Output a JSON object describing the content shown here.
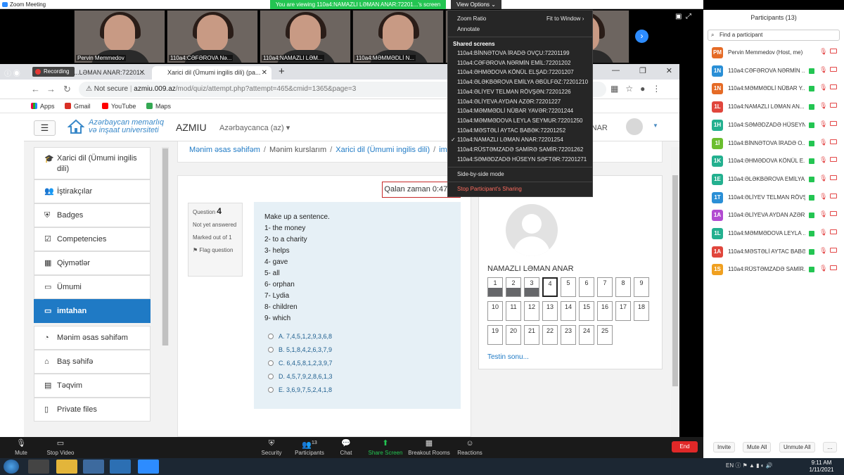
{
  "zoom": {
    "window_title": "Zoom Meeting",
    "viewing_banner": "You are viewing 110a4:NAMAZLI LƏMAN ANAR:72201...'s screen",
    "view_options": "View Options"
  },
  "thumbnails": [
    {
      "name": "Pervin Memmedov"
    },
    {
      "name": "110a4:CƏFƏROVA Nə..."
    },
    {
      "name": "110a4:NAMAZLI LƏM..."
    },
    {
      "name": "110a4:MƏMMƏDLİ N..."
    },
    {
      "name": ""
    },
    {
      "name": ""
    }
  ],
  "browser": {
    "tab1": "Recording...LƏMAN ANAR:72201...",
    "tab2": "Xarici dil (Ümumi ingilis dili) (pa...",
    "recording_badge": "Recording",
    "not_secure": "Not secure",
    "host": "azmiu.009.az",
    "path": "/mod/quiz/attempt.php?attempt=465&cmid=1365&page=3",
    "bookmarks": [
      "Apps",
      "Gmail",
      "YouTube",
      "Maps"
    ]
  },
  "site": {
    "logo_line1": "Azərbaycan memarlıq",
    "logo_line2": "və inşaat universiteti",
    "brand": "AZMIU",
    "language": "Azərbaycanca (az)",
    "user_name": "LƏMAN ANAR"
  },
  "sidebar": {
    "items": [
      {
        "label": "Xarici dil (Ümumi ingilis dili)",
        "icon": "graduation-cap-icon"
      },
      {
        "label": "İştirakçılar",
        "icon": "users-icon"
      },
      {
        "label": "Badges",
        "icon": "shield-icon"
      },
      {
        "label": "Competencies",
        "icon": "checkbox-icon"
      },
      {
        "label": "Qiymətlər",
        "icon": "table-icon"
      },
      {
        "label": "Ümumi",
        "icon": "folder-icon"
      },
      {
        "label": "imtahan",
        "icon": "folder-icon"
      },
      {
        "label": "Mənim əsas səhifəm",
        "icon": "dashboard-icon"
      },
      {
        "label": "Baş səhifə",
        "icon": "home-icon"
      },
      {
        "label": "Təqvim",
        "icon": "calendar-icon"
      },
      {
        "label": "Private files",
        "icon": "file-icon"
      }
    ]
  },
  "breadcrumb": {
    "items": [
      "Mənim əsas səhifəm",
      "Mənim kurslarım",
      "Xarici dil (Ümumi ingilis dili)",
      "im"
    ]
  },
  "quiz": {
    "timer_label": "Qalan zaman 0:47:01",
    "question_word": "Question",
    "question_number": "4",
    "status": "Not yet answered",
    "marked": "Marked out of 1",
    "flag": "Flag question",
    "prompt": "Make up a sentence.",
    "items": [
      "1- the money",
      "2- to a charity",
      "3- helps",
      "4- gave",
      "5- all",
      "6- orphan",
      "7- Lydia",
      "8- children",
      "9- which"
    ],
    "options": [
      "A. 7,4,5,1,2,9,3,6,8",
      "B. 5,1,8,4,2,6,3,7,9",
      "C. 6,4,5,8,1,2,3,9,7",
      "D. 4,5,7,9,2,8,6,1,3",
      "E. 3,6,9,7,5,2,4,1,8"
    ]
  },
  "quiz_nav": {
    "header": "QUIZ NAVIGATION",
    "student": "NAMAZLI LƏMAN ANAR",
    "buttons": [
      "1",
      "2",
      "3",
      "4",
      "5",
      "6",
      "7",
      "8",
      "9",
      "10",
      "11",
      "12",
      "13",
      "14",
      "15",
      "16",
      "17",
      "18",
      "19",
      "20",
      "21",
      "22",
      "23",
      "24",
      "25"
    ],
    "answered_count": 3,
    "current": "4",
    "finish": "Testin sonu..."
  },
  "dropdown": {
    "zoom_ratio": "Zoom Ratio",
    "fit_to_window": "Fit to Window",
    "annotate": "Annotate",
    "shared_screens_header": "Shared screens",
    "screens": [
      "110a4:BİNNƏTOVA İRADƏ OVÇU:72201199",
      "110a4:CƏFƏROVA NƏRMİN EMİL:72201202",
      "110a4:ƏHMƏDOVA KÖNÜL ELŞAD:72201207",
      "110a4:ƏLƏKBƏROVA EMİLYA ƏBÜLFƏZ:72201210",
      "110a4:ƏLİYEV TELMAN RÖVŞƏN:72201226",
      "110a4:ƏLİYEVA AYDAN AZƏR:72201227",
      "110a4:MƏMMƏDLİ NÜBAR YAVƏR:72201244",
      "110a4:MƏMMƏDOVA LEYLA SEYMUR:72201250",
      "110a4:MƏSTƏLİ AYTAC BABƏK:72201252",
      "110a4:NAMAZLI LƏMAN ANAR:72201254",
      "110a4:RÜSTƏMZADƏ SAMİRƏ SAMİR:72201262",
      "110a4:SƏMƏDZADƏ HÜSEYN SƏFTƏR:72201271"
    ],
    "checked_index": 9,
    "side_by_side": "Side-by-side mode",
    "stop": "Stop Participant's Sharing"
  },
  "participants": {
    "title": "Participants (13)",
    "search_placeholder": "Find a participant",
    "list": [
      {
        "initials": "PM",
        "name": "Pervin Memmedov (Host, me)",
        "color": "#e56b26"
      },
      {
        "initials": "1N",
        "name": "110a4:CƏFƏROVA NƏRMİN ...",
        "color": "#2a8fd6"
      },
      {
        "initials": "1N",
        "name": "110a4:MƏMMƏDLİ NÜBAR Y...",
        "color": "#e56b26"
      },
      {
        "initials": "1L",
        "name": "110a4:NAMAZLI LƏMAN AN...",
        "color": "#e0463c"
      },
      {
        "initials": "1H",
        "name": "110a4:SƏMƏDZADƏ HÜSEYN...",
        "color": "#23b08f"
      },
      {
        "initials": "1İ",
        "name": "110a4:BİNNƏTOVA İRADƏ O...",
        "color": "#6bbe2f"
      },
      {
        "initials": "1K",
        "name": "110a4:ƏHMƏDOVA KÖNÜL E...",
        "color": "#23b08f"
      },
      {
        "initials": "1E",
        "name": "110a4:ƏLƏKBƏROVA EMİLYA...",
        "color": "#23b08f"
      },
      {
        "initials": "1T",
        "name": "110a4:ƏLİYEV TELMAN RÖVŞ...",
        "color": "#2a8fd6"
      },
      {
        "initials": "1A",
        "name": "110a4:ƏLİYEVA AYDAN AZƏR...",
        "color": "#b24bd1"
      },
      {
        "initials": "1L",
        "name": "110a4:MƏMMƏDOVA LEYLA ...",
        "color": "#23b08f"
      },
      {
        "initials": "1A",
        "name": "110a4:MƏSTƏLİ AYTAC BABƏ...",
        "color": "#e0463c"
      },
      {
        "initials": "1S",
        "name": "110a4:RÜSTƏMZADƏ SAMİR...",
        "color": "#f0a020"
      }
    ],
    "invite": "Invite",
    "mute_all": "Mute All",
    "unmute_all": "Unmute All"
  },
  "toolbar": {
    "mute": "Mute",
    "stop_video": "Stop Video",
    "security": "Security",
    "participants": "Participants",
    "participants_count": "13",
    "chat": "Chat",
    "share_screen": "Share Screen",
    "breakout": "Breakout Rooms",
    "reactions": "Reactions",
    "end": "End"
  },
  "taskbar": {
    "lang": "EN",
    "time": "9:11 AM",
    "date": "1/11/2021"
  }
}
